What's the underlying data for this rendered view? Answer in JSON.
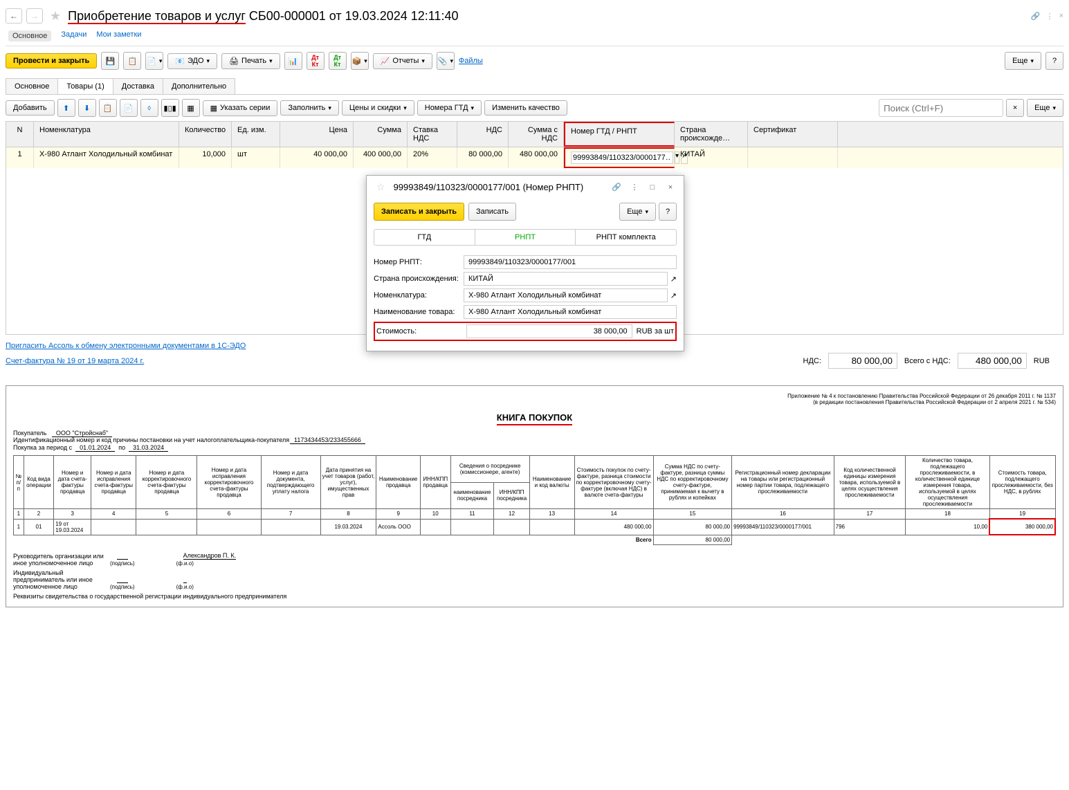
{
  "header": {
    "title_part1": "Приобретение товаров и услуг",
    "title_part2": " СБ00-000001 от 19.03.2024 12:11:40"
  },
  "subtabs": {
    "main": "Основное",
    "tasks": "Задачи",
    "notes": "Мои заметки"
  },
  "maintoolbar": {
    "post_close": "Провести и закрыть",
    "edo": "ЭДО",
    "print": "Печать",
    "reports": "Отчеты",
    "files": "Файлы",
    "more": "Еще"
  },
  "doctabs": {
    "main": "Основное",
    "goods": "Товары (1)",
    "delivery": "Доставка",
    "extra": "Дополнительно"
  },
  "gridtoolbar": {
    "add": "Добавить",
    "series": "Указать серии",
    "fill": "Заполнить",
    "prices": "Цены и скидки",
    "gtd": "Номера ГТД",
    "quality": "Изменить качество",
    "search_placeholder": "Поиск (Ctrl+F)",
    "more": "Еще"
  },
  "grid": {
    "headers": {
      "n": "N",
      "nom": "Номенклатура",
      "qty": "Количество",
      "unit": "Ед. изм.",
      "price": "Цена",
      "sum": "Сумма",
      "vat_rate": "Ставка НДС",
      "vat": "НДС",
      "sum_vat": "Сумма с НДС",
      "gtd": "Номер ГТД / РНПТ",
      "country": "Страна происхожде…",
      "cert": "Сертификат"
    },
    "row": {
      "n": "1",
      "nom": "X-980 Атлант Холодильный комбинат",
      "qty": "10,000",
      "unit": "шт",
      "price": "40 000,00",
      "sum": "400 000,00",
      "vat_rate": "20%",
      "vat": "80 000,00",
      "sum_vat": "480 000,00",
      "gtd": "99993849/110323/0000177…",
      "country": "КИТАЙ"
    }
  },
  "popup": {
    "title": "99993849/110323/0000177/001 (Номер РНПТ)",
    "save_close": "Записать и закрыть",
    "save": "Записать",
    "more": "Еще",
    "tabs": {
      "gtd": "ГТД",
      "rnpt": "РНПТ",
      "rnpt_set": "РНПТ комплекта"
    },
    "form": {
      "num_label": "Номер РНПТ:",
      "num_value": "99993849/110323/0000177/001",
      "country_label": "Страна происхождения:",
      "country_value": "КИТАЙ",
      "nom_label": "Номенклатура:",
      "nom_value": "X-980 Атлант Холодильный комбинат",
      "name_label": "Наименование товара:",
      "name_value": "X-980 Атлант Холодильный комбинат",
      "cost_label": "Стоимость:",
      "cost_value": "38 000,00",
      "cost_unit": "RUB за шт"
    }
  },
  "footer": {
    "invite": "Пригласить Ассоль к обмену электронными документами в 1С-ЭДО",
    "invoice": "Счет-фактура № 19 от 19 марта 2024 г.",
    "vat_label": "НДС:",
    "vat_value": "80 000,00",
    "total_label": "Всего с НДС:",
    "total_value": "480 000,00",
    "currency": "RUB"
  },
  "report": {
    "decree1": "Приложение № 4 к постановлению Правительства Российской Федерации от 26 декабря 2011 г. № 1137",
    "decree2": "(в редакции постановления Правительства Российской Федерации от 2 апреля 2021 г. № 534)",
    "title": "КНИГА ПОКУПОК",
    "buyer_label": "Покупатель",
    "buyer": "ООО \"Стройснаб\"",
    "inn_label": "Идентификационный номер и код причины постановки на учет налогоплательщика-покупателя",
    "inn": "1173434453/233455666",
    "period_label": "Покупка за период с",
    "period_from": "01.01.2024",
    "period_to_label": "по",
    "period_to": "31.03.2024",
    "headers": {
      "c1": "№ п/п",
      "c2": "Код вида операции",
      "c3": "Номер и дата счета-фактуры продавца",
      "c4": "Номер и дата исправления счета-фактуры продавца",
      "c5": "Номер и дата корректировочного счета-фактуры продавца",
      "c6": "Номер и дата исправления корректировочного счета-фактуры продавца",
      "c7": "Номер и дата документа, подтверждающего уплату налога",
      "c8": "Дата принятия на учет товаров (работ, услуг), имущественных прав",
      "c9": "Наименование продавца",
      "c10": "ИНН/КПП продавца",
      "c11_top": "Сведения о посреднике (комиссионере, агенте)",
      "c11": "наименование посредника",
      "c12": "ИНН/КПП посредника",
      "c13": "Наименование и код валюты",
      "c14": "Стоимость покупок по счету-фактуре, разница стоимости по корректировочному счету-фактуре (включая НДС) в валюте счета-фактуры",
      "c15": "Сумма НДС по счету-фактуре, разница суммы НДС по корректировочному счету-фактуре, принимаемая к вычету в рублях и копейках",
      "c16": "Регистрационный номер декларации на товары или регистрационный номер партии товара, подлежащего прослеживаемости",
      "c17": "Код количественной единицы измерения товара, используемой в целях осуществления прослеживаемости",
      "c18": "Количество товара, подлежащего прослеживаемости, в количественной единице измерения товара, используемой в целях осуществления прослеживаемости",
      "c19": "Стоимость товара, подлежащего прослеживаемости, без НДС, в рублях"
    },
    "data": {
      "c1": "1",
      "c2": "01",
      "c3": "19 от 19.03.2024",
      "c8": "19.03.2024",
      "c9": "Ассоль ООО",
      "c14": "480 000,00",
      "c15": "80 000,00",
      "c16": "99993849/110323/0000177/001",
      "c17": "796",
      "c18": "10,00",
      "c19": "380 000,00"
    },
    "total_label": "Всего",
    "total_value": "80 000,00",
    "sig": {
      "head": "Руководитель организации или иное уполномоченное лицо",
      "name": "Александров П. К.",
      "podpis": "(подпись)",
      "fio": "(ф.и.о)",
      "ip": "Индивидуальный предприниматель или иное уполномоченное лицо",
      "req": "Реквизиты свидетельства о государственной регистрации индивидуального предпринимателя"
    }
  }
}
